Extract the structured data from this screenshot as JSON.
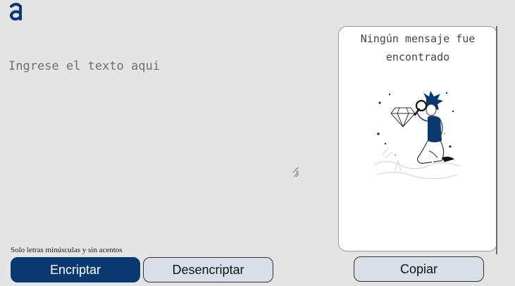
{
  "brand": {
    "logo_icon": "alura-logo-icon",
    "accent_color": "#0a3871"
  },
  "input": {
    "placeholder": "Ingrese el texto aqui",
    "value": ""
  },
  "hint": {
    "text": "Solo letras minúsculas y sin acentos"
  },
  "buttons": {
    "encrypt_label": "Encriptar",
    "decrypt_label": "Desencriptar",
    "copy_label": "Copiar"
  },
  "output": {
    "empty_message": "Ningún mensaje fue encontrado",
    "illustration_icon": "person-with-magnifier-icon"
  }
}
